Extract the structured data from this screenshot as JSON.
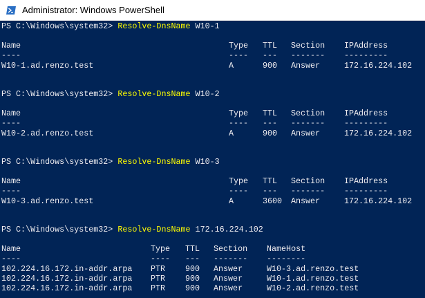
{
  "window": {
    "title": "Administrator: Windows PowerShell",
    "background": "#012456",
    "text_color": "#eeedf0",
    "command_color": "#ffff00",
    "icon": "powershell-icon"
  },
  "blocks": [
    {
      "prompt": "PS C:\\Windows\\system32> ",
      "command": "Resolve-DnsName",
      "argument": " W10-1",
      "headers": [
        "Name",
        "Type",
        "TTL",
        "Section",
        "IPAddress"
      ],
      "separators": [
        "----",
        "----",
        "---",
        "-------",
        "---------"
      ],
      "rows": [
        [
          "W10-1.ad.renzo.test",
          "A",
          "900",
          "Answer",
          "172.16.224.102"
        ]
      ]
    },
    {
      "prompt": "PS C:\\Windows\\system32> ",
      "command": "Resolve-DnsName",
      "argument": " W10-2",
      "headers": [
        "Name",
        "Type",
        "TTL",
        "Section",
        "IPAddress"
      ],
      "separators": [
        "----",
        "----",
        "---",
        "-------",
        "---------"
      ],
      "rows": [
        [
          "W10-2.ad.renzo.test",
          "A",
          "900",
          "Answer",
          "172.16.224.102"
        ]
      ]
    },
    {
      "prompt": "PS C:\\Windows\\system32> ",
      "command": "Resolve-DnsName",
      "argument": " W10-3",
      "headers": [
        "Name",
        "Type",
        "TTL",
        "Section",
        "IPAddress"
      ],
      "separators": [
        "----",
        "----",
        "---",
        "-------",
        "---------"
      ],
      "rows": [
        [
          "W10-3.ad.renzo.test",
          "A",
          "3600",
          "Answer",
          "172.16.224.102"
        ]
      ]
    },
    {
      "prompt": "PS C:\\Windows\\system32> ",
      "command": "Resolve-DnsName",
      "argument": " 172.16.224.102",
      "headers": [
        "Name",
        "Type",
        "TTL",
        "Section",
        "NameHost"
      ],
      "separators": [
        "----",
        "----",
        "---",
        "-------",
        "--------"
      ],
      "rows": [
        [
          "102.224.16.172.in-addr.arpa",
          "PTR",
          "900",
          "Answer",
          "W10-3.ad.renzo.test"
        ],
        [
          "102.224.16.172.in-addr.arpa",
          "PTR",
          "900",
          "Answer",
          "W10-1.ad.renzo.test"
        ],
        [
          "102.224.16.172.in-addr.arpa",
          "PTR",
          "900",
          "Answer",
          "W10-2.ad.renzo.test"
        ]
      ]
    }
  ]
}
